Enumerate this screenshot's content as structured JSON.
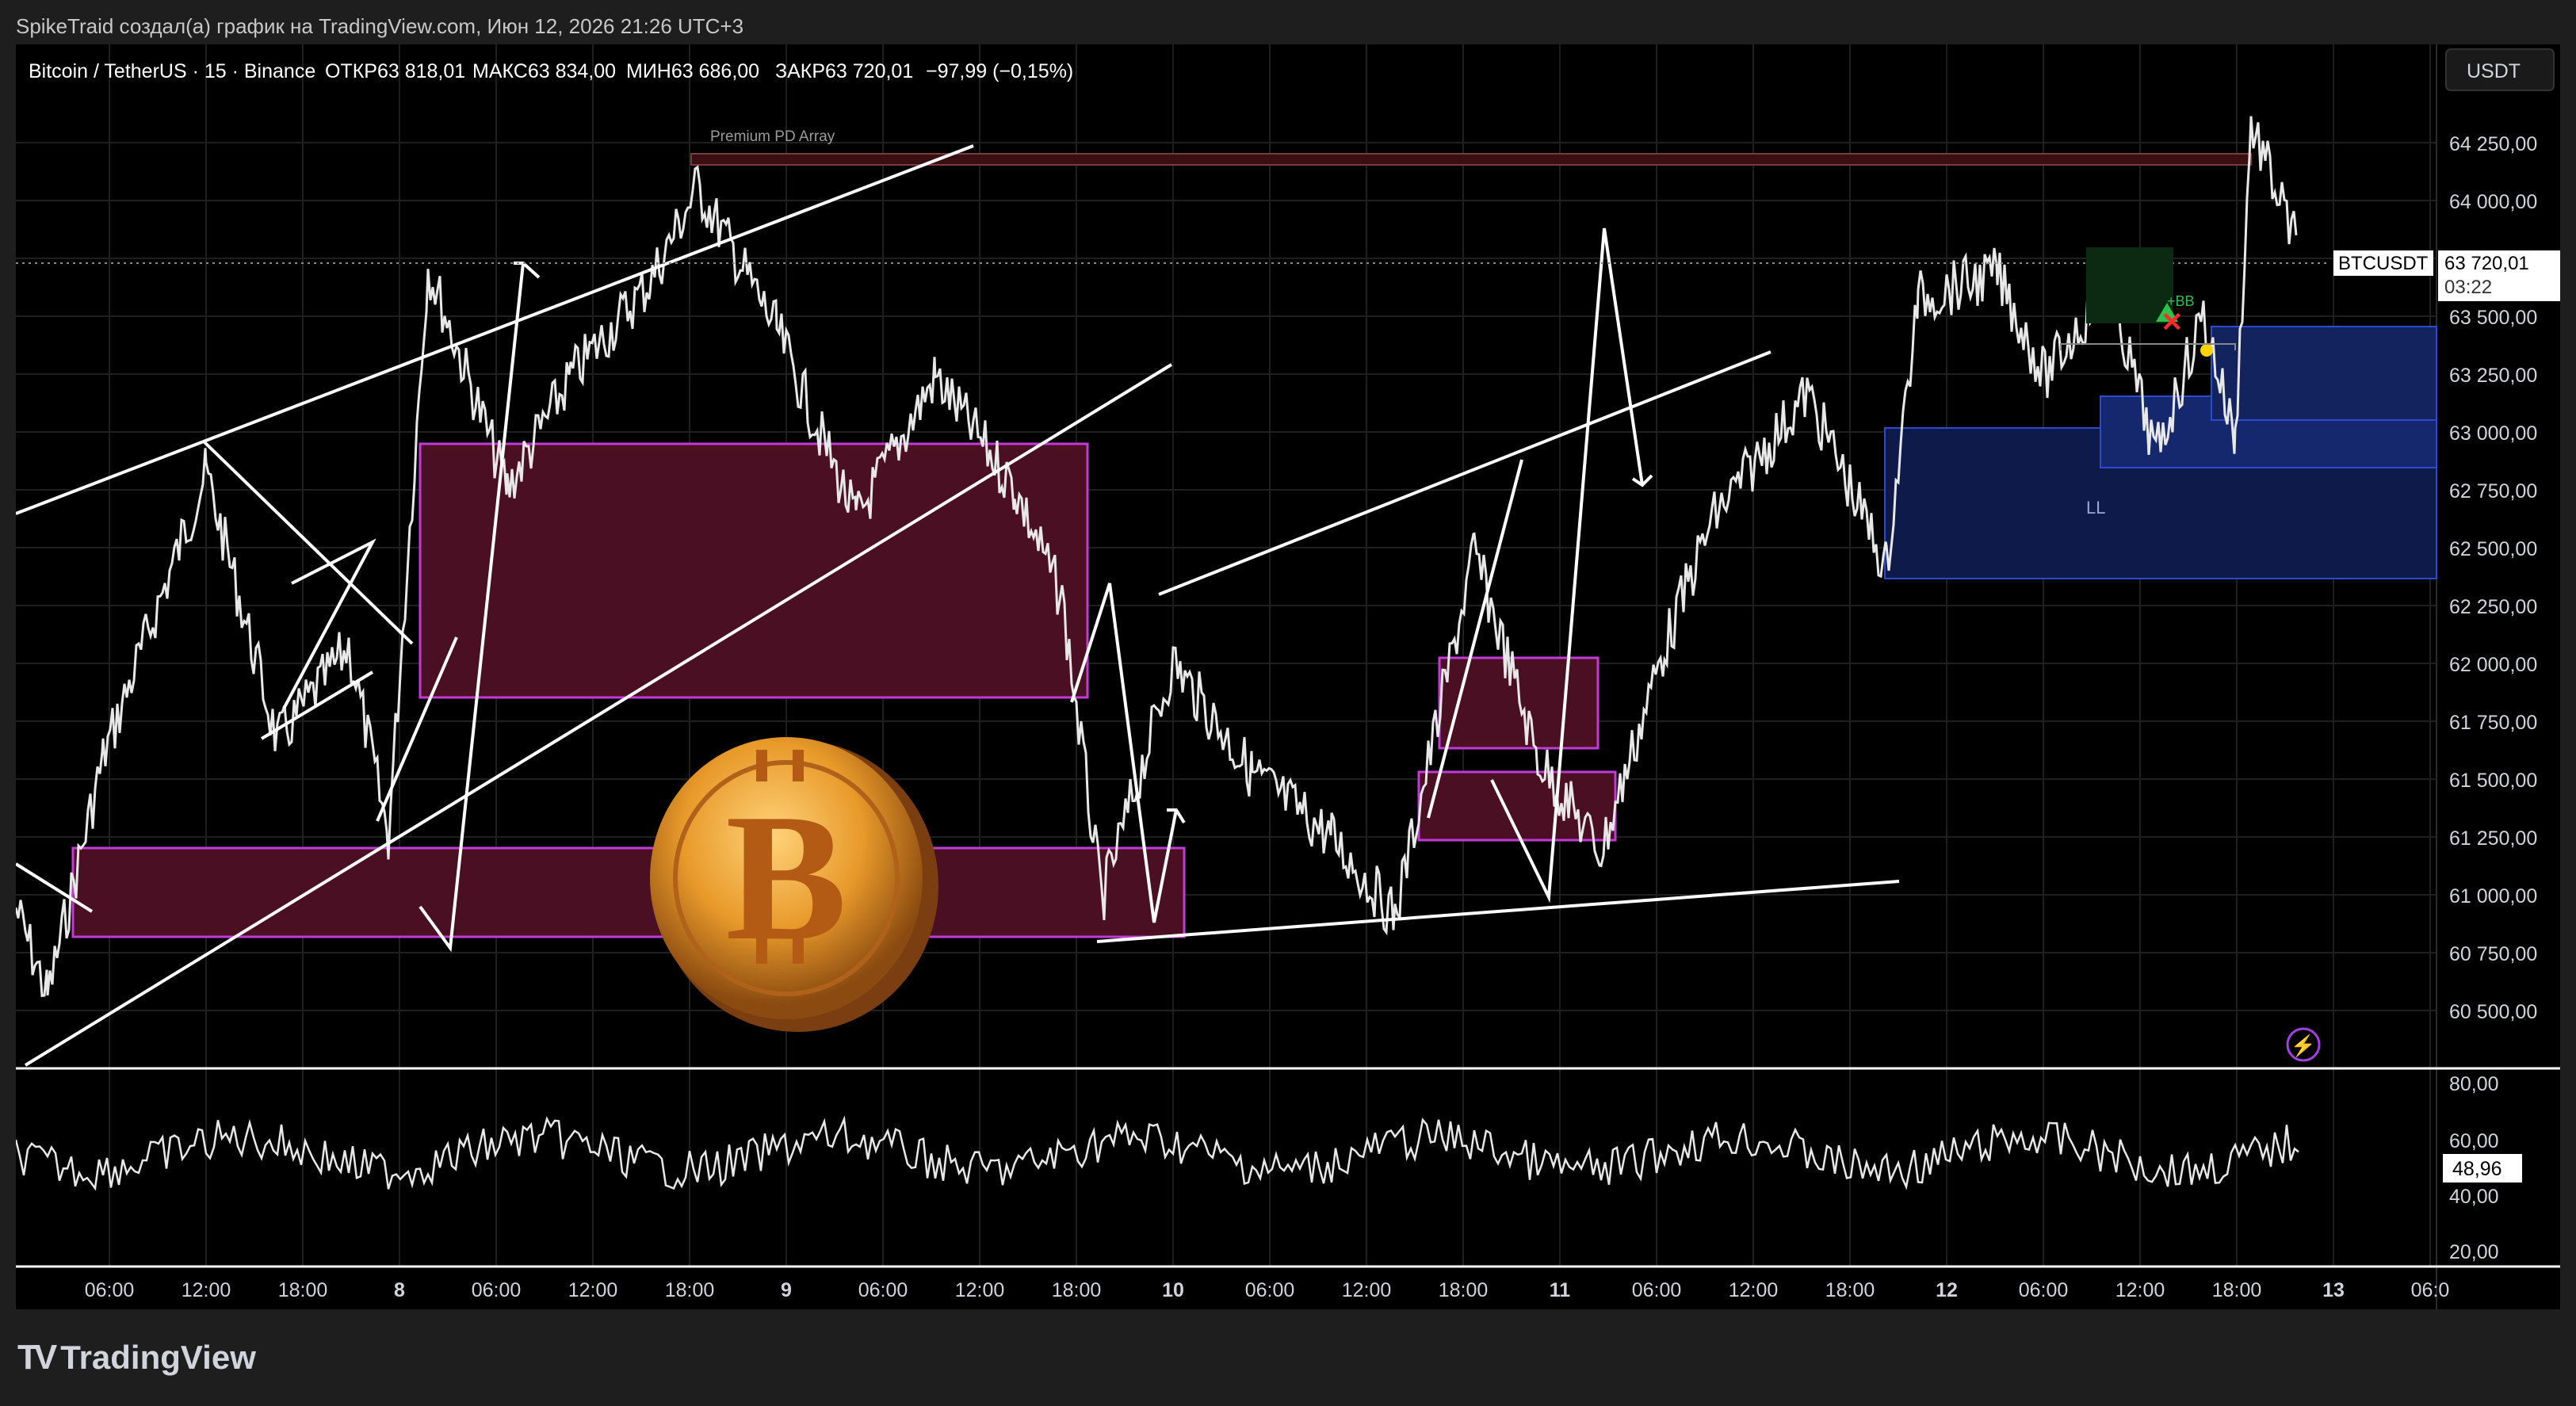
{
  "attribution": "SpikeTraid создал(а) график на TradingView.com, Июн 12, 2026 21:26 UTC+3",
  "symbol_header": {
    "symbol": "Bitcoin / TetherUS · 15 · Binance",
    "open": "ОТКР63 818,01",
    "high": "МАКС63 834,00",
    "low": "МИН63 686,00",
    "close": "ЗАКР63 720,01",
    "change": "−97,99 (−0,15%)"
  },
  "currency_button": "USDT",
  "price_axis": [
    "64 250,00",
    "64 000,00",
    "63 750,00",
    "63 500,00",
    "63 250,00",
    "63 000,00",
    "62 750,00",
    "62 500,00",
    "62 250,00",
    "62 000,00",
    "61 750,00",
    "61 500,00",
    "61 250,00",
    "61 000,00",
    "60 750,00",
    "60 500,00"
  ],
  "price_label": {
    "symbol": "BTCUSDT",
    "price": "63 720,01",
    "countdown": "03:22"
  },
  "rsi_axis": [
    "80,00",
    "60,00",
    "40,00",
    "20,00"
  ],
  "rsi_value": "48,96",
  "time_axis": [
    "06:00",
    "12:00",
    "18:00",
    "8",
    "06:00",
    "12:00",
    "18:00",
    "9",
    "06:00",
    "12:00",
    "18:00",
    "10",
    "06:00",
    "12:00",
    "18:00",
    "11",
    "06:00",
    "12:00",
    "18:00",
    "12",
    "06:00",
    "12:00",
    "18:00",
    "13",
    "06:0"
  ],
  "annotations": {
    "premium": "Premium PD Array",
    "ll": "LL",
    "ibb": "+BB"
  },
  "footer": {
    "brand": "TradingView",
    "mark": "TV"
  },
  "colors": {
    "background": "#000000",
    "zone_fill": "#4a0f22",
    "zone_border": "#c23bd6",
    "blue_zone": "#1a2f7a",
    "accent_red": "#ff2a2a"
  }
}
